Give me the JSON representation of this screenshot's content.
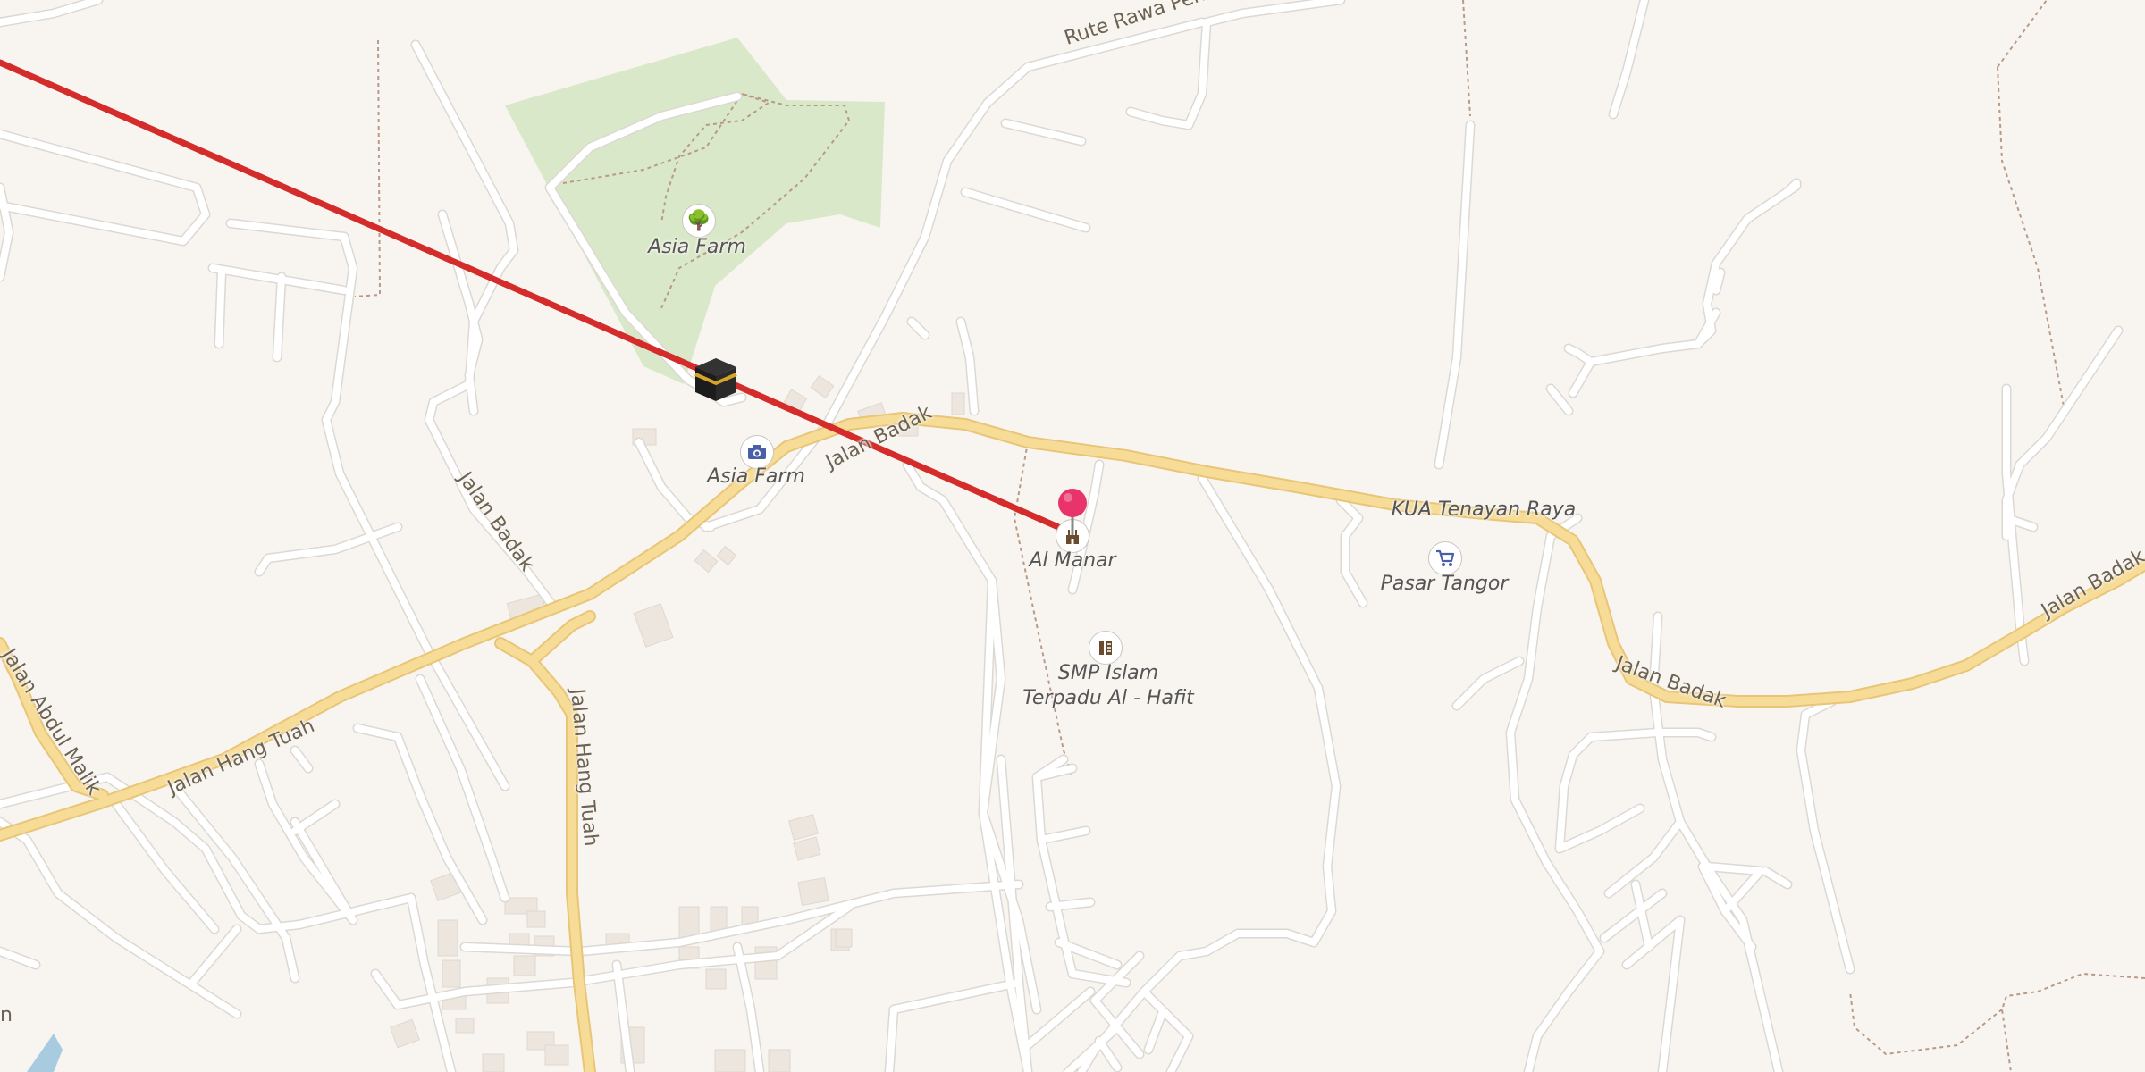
{
  "map": {
    "colors": {
      "background": "#f8f5f1",
      "park": "#d9e8c8",
      "primary_road": "#f7dc97",
      "primary_road_casing": "#e8c577",
      "minor_road": "#ffffff",
      "minor_road_casing": "#dcd8d2",
      "route_line": "#d42b2b",
      "marker": "#e8346a",
      "water": "#a9cbe0",
      "building": "#ece6df",
      "footpath": "#b89a86"
    },
    "road_labels": {
      "rute_rawa_pendek": "Rute Rawa Pendek",
      "jalan_badak_1": "Jalan Badak",
      "jalan_badak_2": "Jalan Badak",
      "jalan_badak_3": "Jalan Badak",
      "jalan_badak_4": "Jalan Badak",
      "jalan_hang_tuah_1": "Jalan Hang Tuah",
      "jalan_hang_tuah_2": "Jalan Hang Tuah",
      "jalan_abdul_malik": "Jalan Abdul Malik",
      "edge_fragment": "n"
    },
    "pois": {
      "asia_farm_park": {
        "label": "Asia Farm",
        "icon": "tree-icon"
      },
      "asia_farm_viewpoint": {
        "label": "Asia Farm",
        "icon": "camera-icon"
      },
      "kaaba": {
        "icon": "kaaba-icon"
      },
      "al_manar": {
        "label": "Al Manar",
        "icon": "mosque-icon"
      },
      "smp_islam_line1": "SMP Islam",
      "smp_islam_line2": "Terpadu Al - Hafit",
      "smp_icon": "school-icon",
      "kua_tenayan_raya": "KUA Tenayan Raya",
      "pasar_tangor": {
        "label": "Pasar Tangor",
        "icon": "shopping-cart-icon"
      }
    },
    "markers": {
      "selected_location": "map-pin-icon"
    }
  }
}
